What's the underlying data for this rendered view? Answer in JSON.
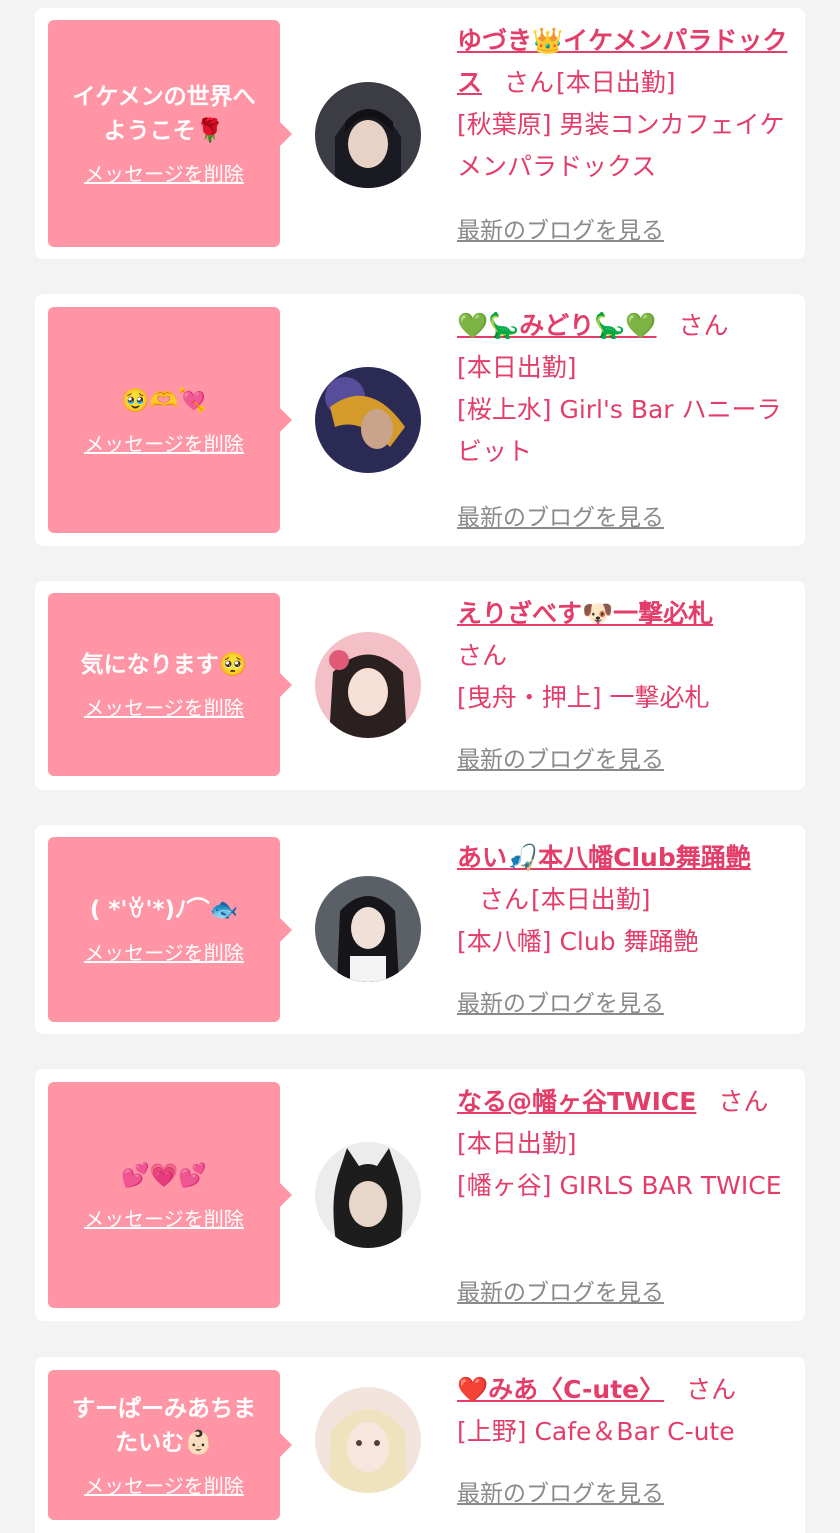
{
  "cards": [
    {
      "message": "イケメンの世界へ\nようこそ🌹",
      "delete_label": "メッセージを削除",
      "name": "ゆづき👑イケメンパラドックス",
      "honorific": "さん",
      "status": "[本日出勤]",
      "shop": "[秋葉原] 男装コンカフェイケメンパラドックス",
      "blog_label": "最新のブログを見る"
    },
    {
      "message": "🥹🫶💘",
      "delete_label": "メッセージを削除",
      "name": "💚🦕みどり🦕💚",
      "honorific": "さん",
      "status": "[本日出勤]",
      "shop": "[桜上水] Girl's Bar ハニーラビット",
      "blog_label": "最新のブログを見る"
    },
    {
      "message": "気になります🥺",
      "delete_label": "メッセージを削除",
      "name": "えりざべす🐶一撃必札",
      "honorific": "さん",
      "status": "",
      "shop": "[曳舟・押上] 一撃必札",
      "blog_label": "最新のブログを見る"
    },
    {
      "message": "( *'ꈊ'*)ﾉ⌒🐟",
      "delete_label": "メッセージを削除",
      "name": "あい🎣本八幡Club舞踊艶",
      "honorific": "さん",
      "status": "[本日出勤]",
      "shop": "[本八幡] Club 舞踊艶",
      "blog_label": "最新のブログを見る"
    },
    {
      "message": "💕💗💕",
      "delete_label": "メッセージを削除",
      "name": "なる@幡ヶ谷TWICE",
      "honorific": "さん",
      "status": "[本日出勤]",
      "shop": "[幡ヶ谷] GIRLS BAR TWICE",
      "blog_label": "最新のブログを見る"
    },
    {
      "message": "すーぱーみあちま\nたいむ👶🏻",
      "delete_label": "メッセージを削除",
      "name": "❤️みあ〈C-ute〉",
      "honorific": "さん",
      "status": "",
      "shop": "[上野] Cafe＆Bar C-ute",
      "blog_label": "最新のブログを見る"
    }
  ]
}
